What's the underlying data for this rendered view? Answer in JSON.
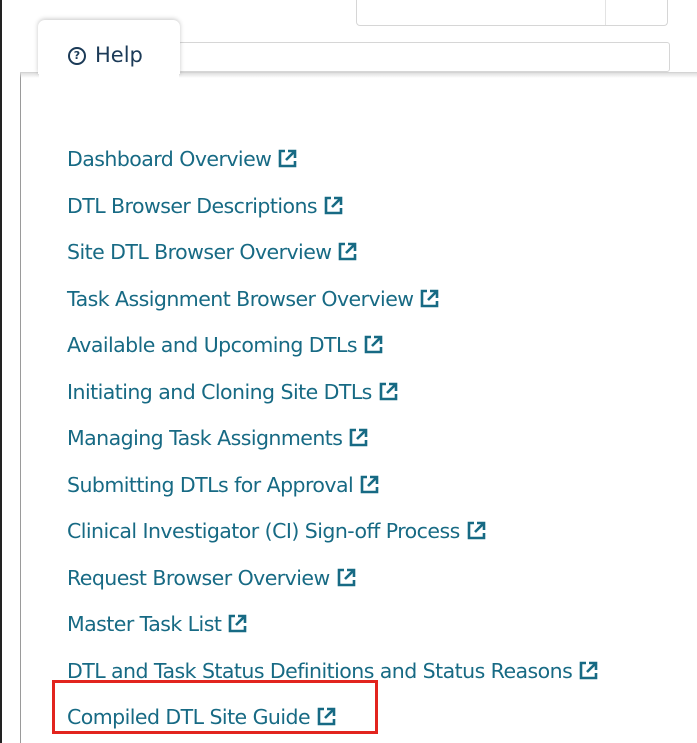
{
  "help_tab": {
    "label": "Help",
    "icon": "help-circle-icon"
  },
  "links": [
    {
      "label": "Dashboard Overview",
      "icon": "external-link-icon"
    },
    {
      "label": "DTL Browser Descriptions",
      "icon": "external-link-icon"
    },
    {
      "label": "Site DTL Browser Overview",
      "icon": "external-link-icon"
    },
    {
      "label": "Task Assignment Browser Overview",
      "icon": "external-link-icon"
    },
    {
      "label": "Available and Upcoming DTLs",
      "icon": "external-link-icon"
    },
    {
      "label": "Initiating and Cloning Site DTLs",
      "icon": "external-link-icon"
    },
    {
      "label": "Managing Task Assignments",
      "icon": "external-link-icon"
    },
    {
      "label": "Submitting DTLs for Approval",
      "icon": "external-link-icon"
    },
    {
      "label": "Clinical Investigator (CI) Sign-off Process",
      "icon": "external-link-icon"
    },
    {
      "label": "Request Browser Overview",
      "icon": "external-link-icon"
    },
    {
      "label": "Master Task List",
      "icon": "external-link-icon"
    },
    {
      "label": "DTL and Task Status Definitions and Status Reasons",
      "icon": "external-link-icon"
    },
    {
      "label": "Compiled DTL Site Guide",
      "icon": "external-link-icon",
      "highlighted": true
    }
  ],
  "colors": {
    "link": "#176a84",
    "tab_text": "#1b3a57",
    "highlight": "#e2241e"
  }
}
